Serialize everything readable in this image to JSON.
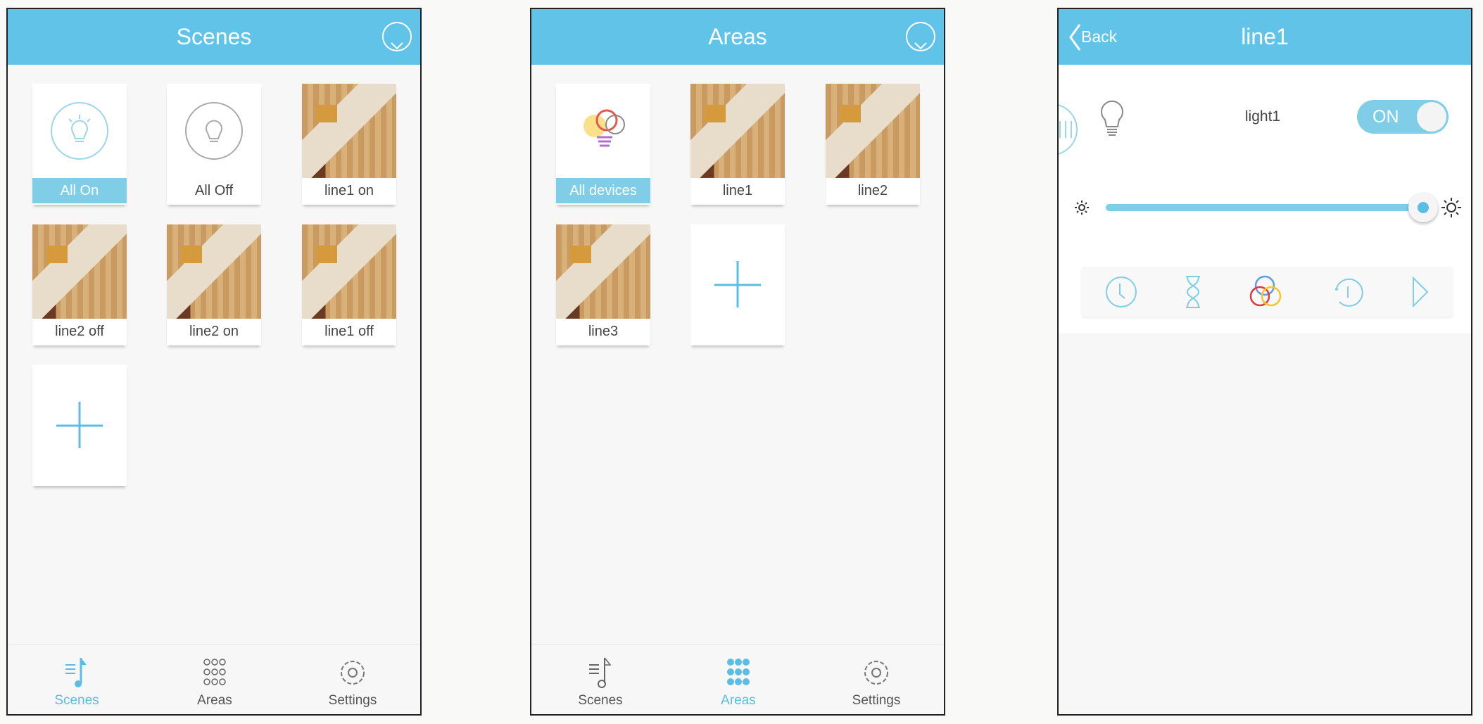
{
  "colors": {
    "accent": "#62c3e8",
    "active_tab": "#5bbde3"
  },
  "scenes_screen": {
    "title": "Scenes",
    "tiles": [
      {
        "label": "All On",
        "icon": "bulb-on-icon",
        "selected": true
      },
      {
        "label": "All Off",
        "icon": "bulb-off-icon"
      },
      {
        "label": "line1 on",
        "icon": "room-photo"
      },
      {
        "label": "line2 off",
        "icon": "room-photo"
      },
      {
        "label": "line2 on",
        "icon": "room-photo"
      },
      {
        "label": "line1 off",
        "icon": "room-photo"
      }
    ],
    "add_icon": "plus-icon",
    "tabs": [
      {
        "label": "Scenes",
        "active": true
      },
      {
        "label": "Areas"
      },
      {
        "label": "Settings"
      }
    ]
  },
  "areas_screen": {
    "title": "Areas",
    "tiles": [
      {
        "label": "All devices",
        "icon": "multicolor-bulbs-icon",
        "selected": true
      },
      {
        "label": "line1",
        "icon": "room-photo"
      },
      {
        "label": "line2",
        "icon": "room-photo"
      },
      {
        "label": "line3",
        "icon": "room-photo"
      }
    ],
    "add_icon": "plus-icon",
    "tabs": [
      {
        "label": "Scenes"
      },
      {
        "label": "Areas",
        "active": true
      },
      {
        "label": "Settings"
      }
    ]
  },
  "detail_screen": {
    "back_label": "Back",
    "title": "line1",
    "device_name": "light1",
    "toggle_label": "ON",
    "toggle_on": true,
    "brightness_percent": 100,
    "toolbar_icons": [
      "clock-icon",
      "hourglass-icon",
      "color-circles-icon",
      "countdown-icon",
      "play-icon"
    ]
  }
}
